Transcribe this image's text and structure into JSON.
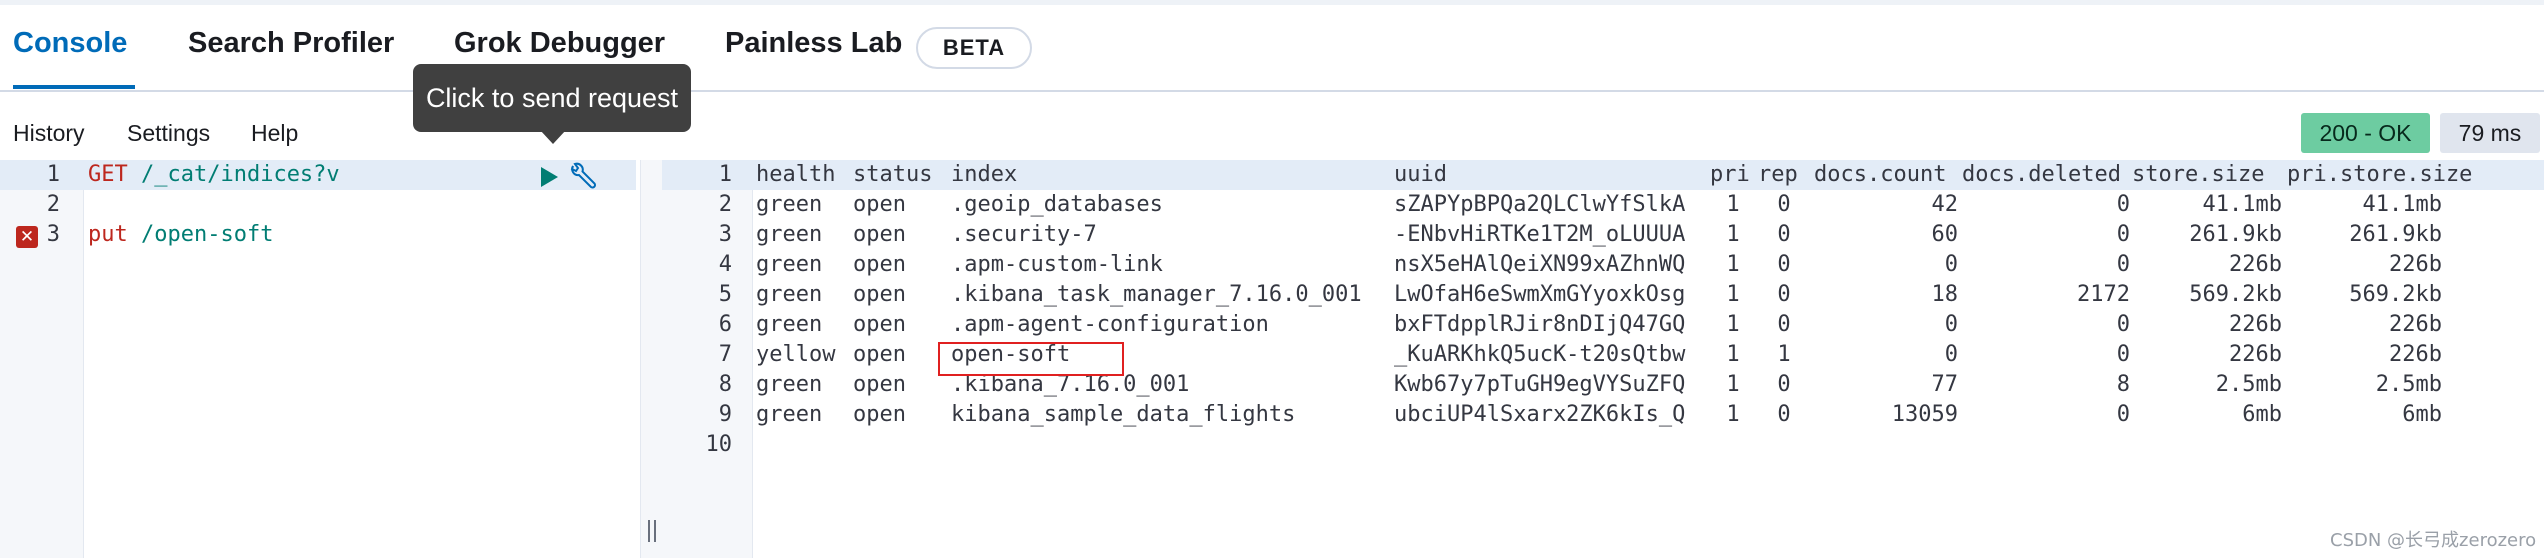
{
  "tabs": [
    {
      "label": "Console"
    },
    {
      "label": "Search Profiler"
    },
    {
      "label": "Grok Debugger"
    },
    {
      "label": "Painless Lab"
    }
  ],
  "beta_label": "BETA",
  "toolbar": {
    "history": "History",
    "settings": "Settings",
    "help": "Help"
  },
  "tooltip": "Click to send request",
  "response": {
    "status": "200 - OK",
    "time": "79 ms"
  },
  "editor": {
    "lines": [
      {
        "num": "1",
        "method": "GET",
        "path": " /_cat/indices?v"
      },
      {
        "num": "2",
        "method": "",
        "path": ""
      },
      {
        "num": "3",
        "method": "put",
        "path": " /open-soft"
      }
    ],
    "error_icon": "✕"
  },
  "output": {
    "line_numbers": [
      "1",
      "2",
      "3",
      "4",
      "5",
      "6",
      "7",
      "8",
      "9",
      "10"
    ],
    "columns": [
      "health",
      "status",
      "index",
      "uuid",
      "pri",
      "rep",
      "docs.count",
      "docs.deleted",
      "store.size",
      "pri.store.size"
    ],
    "rows": [
      [
        "green",
        "open",
        ".geoip_databases",
        "sZAPYpBPQa2QLClwYfSlkA",
        "1",
        "0",
        "42",
        "0",
        "41.1mb",
        "41.1mb"
      ],
      [
        "green",
        "open",
        ".security-7",
        "-ENbvHiRTKe1T2M_oLUUUA",
        "1",
        "0",
        "60",
        "0",
        "261.9kb",
        "261.9kb"
      ],
      [
        "green",
        "open",
        ".apm-custom-link",
        "nsX5eHAlQeiXN99xAZhnWQ",
        "1",
        "0",
        "0",
        "0",
        "226b",
        "226b"
      ],
      [
        "green",
        "open",
        ".kibana_task_manager_7.16.0_001",
        "LwOfaH6eSwmXmGYyoxkOsg",
        "1",
        "0",
        "18",
        "2172",
        "569.2kb",
        "569.2kb"
      ],
      [
        "green",
        "open",
        ".apm-agent-configuration",
        "bxFTdpplRJir8nDIjQ47GQ",
        "1",
        "0",
        "0",
        "0",
        "226b",
        "226b"
      ],
      [
        "yellow",
        "open",
        "open-soft",
        "_KuARKhkQ5ucK-t20sQtbw",
        "1",
        "1",
        "0",
        "0",
        "226b",
        "226b"
      ],
      [
        "green",
        "open",
        ".kibana_7.16.0_001",
        "Kwb67y7pTuGH9egVYSuZFQ",
        "1",
        "0",
        "77",
        "8",
        "2.5mb",
        "2.5mb"
      ],
      [
        "green",
        "open",
        "kibana_sample_data_flights",
        "ubciUP4lSxarx2ZK6kIs_Q",
        "1",
        "0",
        "13059",
        "0",
        "6mb",
        "6mb"
      ]
    ]
  },
  "watermark": "CSDN @长弓成zerozero"
}
